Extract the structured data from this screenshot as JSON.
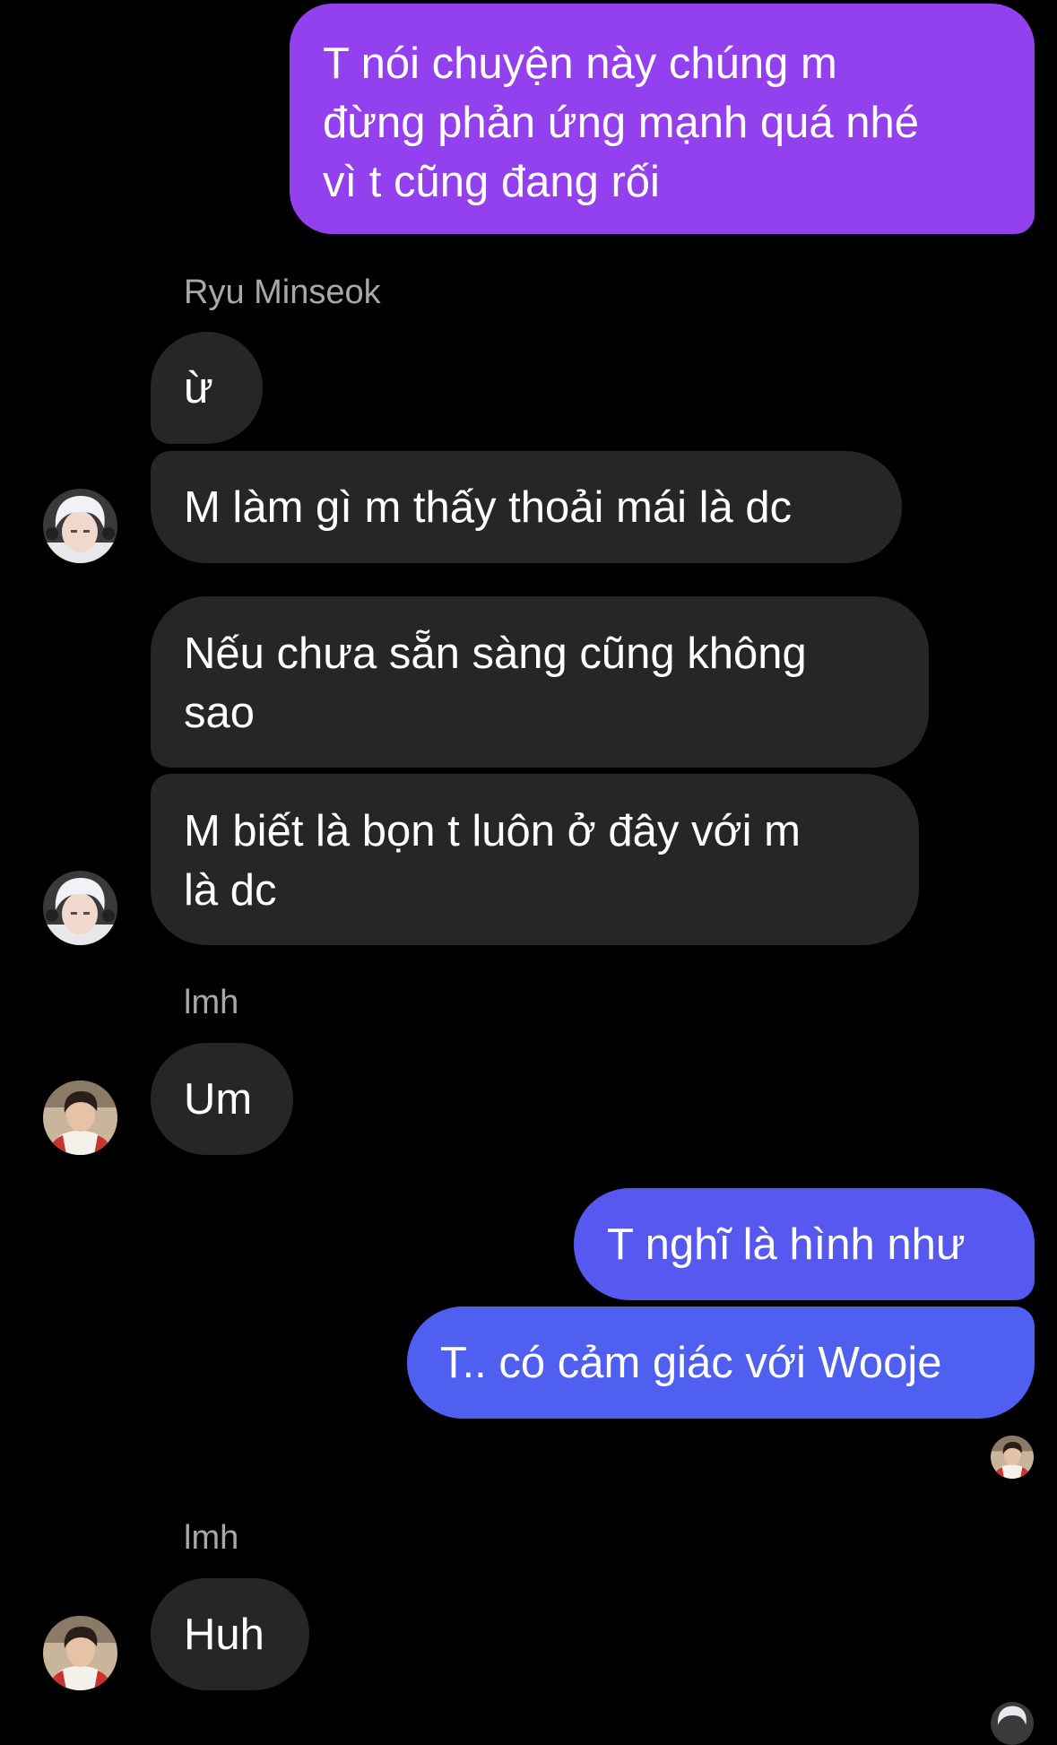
{
  "colors": {
    "background": "#000000",
    "incoming_bubble": "#262626",
    "outgoing_gradient_top": "#9b3cf0",
    "outgoing_gradient_mid": "#6f4cf0",
    "outgoing_gradient_bottom": "#4a5ff0",
    "sender_name": "#a8a8a8"
  },
  "chat": {
    "messages": [
      {
        "from": "me",
        "text": "T nói chuyện này chúng m\nđừng phản ứng mạnh quá nhé\nvì t cũng đang rối"
      },
      {
        "sender_label": "Ryu Minseok"
      },
      {
        "from": "Ryu Minseok",
        "text": "ừ"
      },
      {
        "from": "Ryu Minseok",
        "text": "M làm gì m thấy thoải mái là dc",
        "avatar": "ryu-minseok-avatar"
      },
      {
        "from": "Ryu Minseok",
        "text": "Nếu chưa sẵn sàng cũng không\nsao"
      },
      {
        "from": "Ryu Minseok",
        "text": "M biết là bọn t luôn ở đây với m\nlà dc",
        "avatar": "ryu-minseok-avatar"
      },
      {
        "sender_label": "lmh"
      },
      {
        "from": "lmh",
        "text": "Um",
        "avatar": "lmh-avatar"
      },
      {
        "from": "me",
        "text": "T nghĩ là hình như"
      },
      {
        "from": "me",
        "text": "T.. có cảm giác với Wooje",
        "seen_by": "lmh-seen-avatar"
      },
      {
        "sender_label": "lmh"
      },
      {
        "from": "lmh",
        "text": "Huh",
        "avatar": "lmh-avatar"
      }
    ]
  }
}
